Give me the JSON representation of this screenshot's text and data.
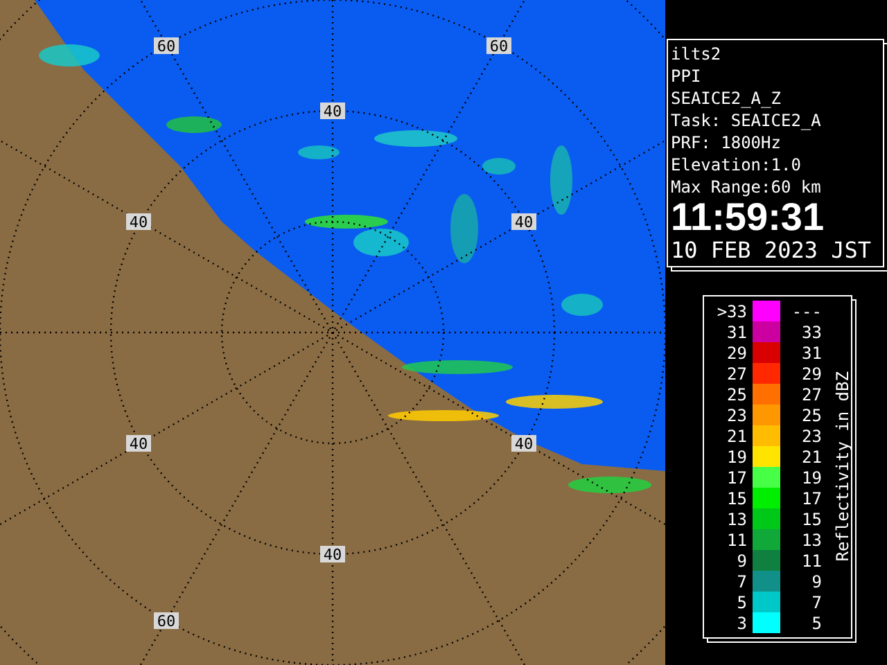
{
  "map": {
    "range_labels": [
      "60",
      "60",
      "40",
      "40",
      "40",
      "40",
      "40",
      "40",
      "60"
    ]
  },
  "info": {
    "station": "ilts2",
    "mode": "PPI",
    "product": "SEAICE2_A_Z",
    "task": "Task: SEAICE2_A",
    "prf": "PRF: 1800Hz",
    "elevation": "Elevation:1.0",
    "max_range": "Max Range:60 km",
    "time": "11:59:31",
    "date": "10 FEB 2023 JST"
  },
  "legend": {
    "title": "Reflectivity in dBZ",
    "rows": [
      {
        "low": ">33",
        "high": "---",
        "color": "#ff00ff"
      },
      {
        "low": "31",
        "high": "33",
        "color": "#cc00a0"
      },
      {
        "low": "29",
        "high": "31",
        "color": "#d80000"
      },
      {
        "low": "27",
        "high": "29",
        "color": "#ff2800"
      },
      {
        "low": "25",
        "high": "27",
        "color": "#ff7000"
      },
      {
        "low": "23",
        "high": "25",
        "color": "#ff9800"
      },
      {
        "low": "21",
        "high": "23",
        "color": "#ffbc00"
      },
      {
        "low": "19",
        "high": "21",
        "color": "#ffe400"
      },
      {
        "low": "17",
        "high": "19",
        "color": "#48ff48"
      },
      {
        "low": "15",
        "high": "17",
        "color": "#00ee00"
      },
      {
        "low": "13",
        "high": "15",
        "color": "#00c818"
      },
      {
        "low": "11",
        "high": "13",
        "color": "#10a838"
      },
      {
        "low": "9",
        "high": "11",
        "color": "#108040"
      },
      {
        "low": "7",
        "high": "9",
        "color": "#109088"
      },
      {
        "low": "5",
        "high": "7",
        "color": "#00c8c8"
      },
      {
        "low": "3",
        "high": "5",
        "color": "#00ffff"
      }
    ]
  }
}
